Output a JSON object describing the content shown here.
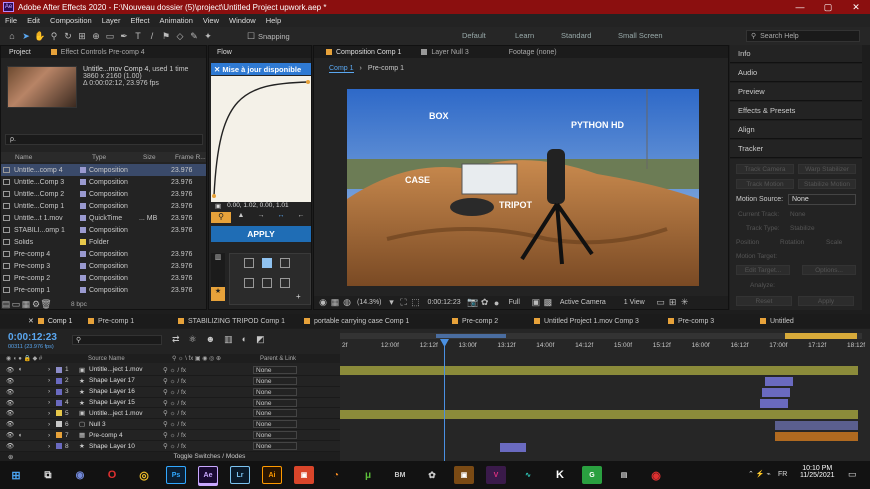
{
  "window": {
    "title": "Adobe After Effects 2020 - F:\\Nouveau dossier (5)\\project\\Untitled Project upwork.aep *"
  },
  "menu": [
    "File",
    "Edit",
    "Composition",
    "Layer",
    "Effect",
    "Animation",
    "View",
    "Window",
    "Help"
  ],
  "toolbar": {
    "snapping": "Snapping",
    "workspaces": [
      "Default",
      "Learn",
      "Standard",
      "Small Screen"
    ],
    "search_placeholder": "Search Help"
  },
  "project": {
    "tab": "Project",
    "effect_controls_tab": "Effect Controls  Pre-comp 4",
    "selected_name": "Untitle...mov Comp 4",
    "selected_used": ", used 1 time",
    "selected_dims": "3860 x 2160 (1.00)",
    "selected_duration": "Δ 0:00:02:12, 23.976 fps",
    "search_placeholder": "ρ.",
    "columns": [
      "Name",
      "Type",
      "Size",
      "Frame R..."
    ],
    "items": [
      {
        "name": "Untitle...comp 4",
        "type": "Composition",
        "size": "",
        "fps": "23.976",
        "color": "#9a9ad0",
        "icon": "comp"
      },
      {
        "name": "Untitle...Comp 3",
        "type": "Composition",
        "size": "",
        "fps": "23.976",
        "color": "#9a9ad0",
        "icon": "comp"
      },
      {
        "name": "Untitle...Comp 2",
        "type": "Composition",
        "size": "",
        "fps": "23.976",
        "color": "#9a9ad0",
        "icon": "comp"
      },
      {
        "name": "Untitle...Comp 1",
        "type": "Composition",
        "size": "",
        "fps": "23.976",
        "color": "#9a9ad0",
        "icon": "comp"
      },
      {
        "name": "Untitle...t 1.mov",
        "type": "QuickTime",
        "size": "... MB",
        "fps": "23.976",
        "color": "#9a9ad0",
        "icon": "mov"
      },
      {
        "name": "STABILI...omp 1",
        "type": "Composition",
        "size": "",
        "fps": "23.976",
        "color": "#9a9ad0",
        "icon": "comp"
      },
      {
        "name": "Solids",
        "type": "Folder",
        "size": "",
        "fps": "",
        "color": "#e7c84a",
        "icon": "folder"
      },
      {
        "name": "Pre-comp 4",
        "type": "Composition",
        "size": "",
        "fps": "23.976",
        "color": "#9a9ad0",
        "icon": "comp"
      },
      {
        "name": "Pre-comp 3",
        "type": "Composition",
        "size": "",
        "fps": "23.976",
        "color": "#9a9ad0",
        "icon": "comp"
      },
      {
        "name": "Pre-comp 2",
        "type": "Composition",
        "size": "",
        "fps": "23.976",
        "color": "#9a9ad0",
        "icon": "comp"
      },
      {
        "name": "Pre-comp 1",
        "type": "Composition",
        "size": "",
        "fps": "23.976",
        "color": "#9a9ad0",
        "icon": "comp"
      }
    ],
    "bpc": "8 bpc"
  },
  "flow": {
    "tab": "Flow",
    "update_label": "✕ Mise à jour disponible",
    "curve_values": "0.00, 1.02, 0.00, 1.01",
    "apply_label": "APPLY"
  },
  "composition": {
    "tab": "Composition  Comp 1",
    "layer_tab": "Layer  Null 3",
    "footage_tab": "Footage  (none)",
    "breadcrumb": [
      "Comp 1",
      "Pre-comp 1"
    ],
    "labels": [
      "BOX",
      "PYTHON HD",
      "CASE",
      "TRIPOT"
    ],
    "zoom": "(14.3%)",
    "timecode": "0:00:12:23",
    "resolution": "Full",
    "camera": "Active Camera",
    "view": "1 View"
  },
  "right_panels": [
    "Info",
    "Audio",
    "Preview",
    "Effects & Presets",
    "Align",
    "Tracker"
  ],
  "tracker": {
    "buttons": [
      "Track Camera",
      "Warp Stabilizer",
      "Track Motion",
      "Stabilize Motion"
    ],
    "motion_source_label": "Motion Source:",
    "motion_source_value": "None",
    "current_track_label": "Current Track:",
    "current_track_value": "None",
    "track_type_label": "Track Type:",
    "track_type_value": "Stabilize",
    "checks": [
      "Position",
      "Rotation",
      "Scale"
    ],
    "motion_target": "Motion Target:",
    "edit_target": "Edit Target...",
    "options": "Options...",
    "analyze": "Analyze:",
    "reset": "Reset",
    "apply": "Apply"
  },
  "timeline": {
    "tabs": [
      "Comp 1",
      "Pre-comp 1",
      "STABILIZING TRIPOD Comp 1",
      "portable carrying case Comp 1",
      "Pre-comp 2",
      "Untitled Project 1.mov Comp 3",
      "Pre-comp 3",
      "Untitled"
    ],
    "timecode": "0:00:12:23",
    "frames": "00311 (23.976 fps)",
    "col_source": "Source Name",
    "col_parent": "Parent & Link",
    "ruler": [
      "2f",
      "12:00f",
      "12:12f",
      "13:00f",
      "13:12f",
      "14:00f",
      "14:12f",
      "15:00f",
      "15:12f",
      "16:00f",
      "16:12f",
      "17:00f",
      "17:12f",
      "18:12f"
    ],
    "layers": [
      {
        "num": "1",
        "name": "Untitle...ject 1.mov",
        "color": "#8c8cc8",
        "icon": "mov",
        "parent": "None"
      },
      {
        "num": "2",
        "name": "Shape Layer 17",
        "color": "#6a6ac0",
        "icon": "star",
        "parent": "None"
      },
      {
        "num": "3",
        "name": "Shape Layer 16",
        "color": "#6a6ac0",
        "icon": "star",
        "parent": "None"
      },
      {
        "num": "4",
        "name": "Shape Layer 15",
        "color": "#6a6ac0",
        "icon": "star",
        "parent": "None"
      },
      {
        "num": "5",
        "name": "Untitle...ject 1.mov",
        "color": "#e7c84a",
        "icon": "mov",
        "parent": "None"
      },
      {
        "num": "6",
        "name": "Null 3",
        "color": "#c8c8c8",
        "icon": "null",
        "parent": "None"
      },
      {
        "num": "7",
        "name": "Pre-comp 4",
        "color": "#e7a23a",
        "icon": "comp",
        "parent": "None"
      },
      {
        "num": "8",
        "name": "Shape Layer 10",
        "color": "#6a6ac0",
        "icon": "star",
        "parent": "None"
      }
    ],
    "toggle_label": "Toggle Switches / Modes"
  },
  "taskbar": {
    "apps": [
      "Ps",
      "Ae",
      "Lr",
      "Ai"
    ],
    "lang": "FR",
    "time": "10:10 PM",
    "date": "11/25/2021"
  }
}
